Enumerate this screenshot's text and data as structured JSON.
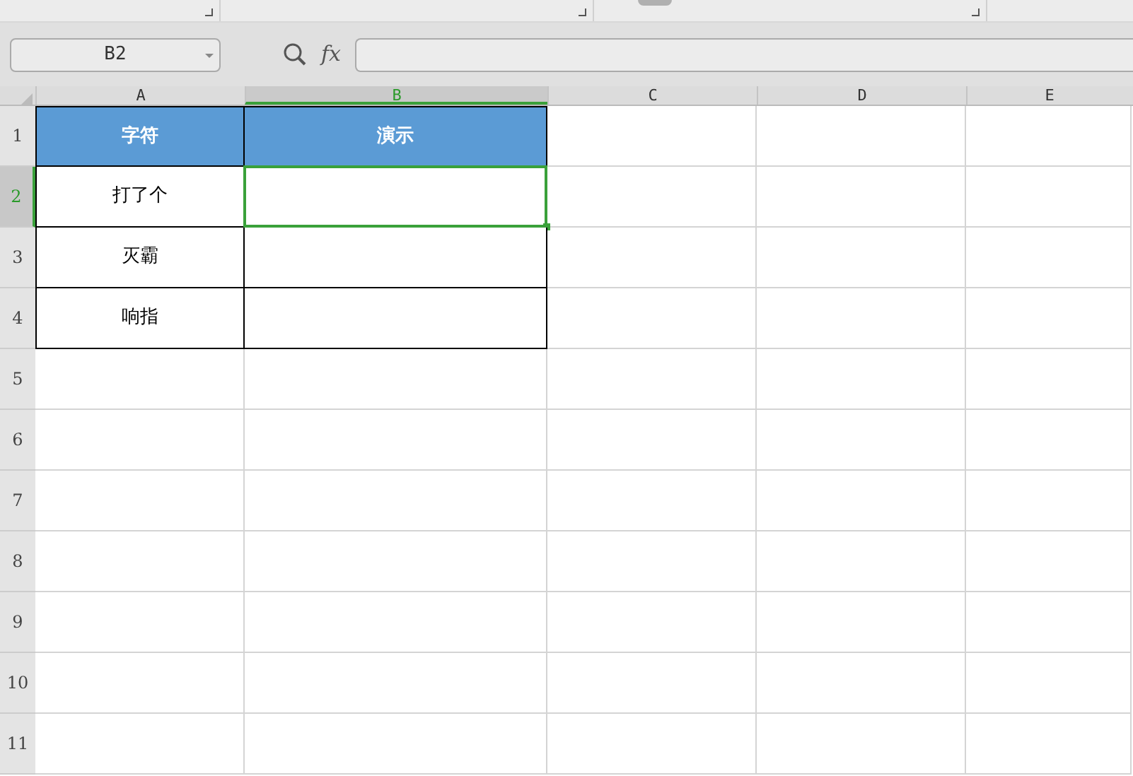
{
  "name_box": {
    "value": "B2"
  },
  "formula_bar": {
    "label": "fx"
  },
  "columns": [
    {
      "label": "A",
      "selected": false
    },
    {
      "label": "B",
      "selected": true
    },
    {
      "label": "C",
      "selected": false
    },
    {
      "label": "D",
      "selected": false
    },
    {
      "label": "E",
      "selected": false
    }
  ],
  "rows": [
    {
      "number": "1",
      "selected": false,
      "cells": [
        {
          "kind": "header",
          "text": "字符",
          "selected": false
        },
        {
          "kind": "header",
          "text": "演示",
          "selected": false
        }
      ]
    },
    {
      "number": "2",
      "selected": true,
      "cells": [
        {
          "kind": "boxed",
          "text": "打了个",
          "selected": false
        },
        {
          "kind": "boxed",
          "selected": true
        }
      ]
    },
    {
      "number": "3",
      "selected": false,
      "cells": [
        {
          "kind": "boxed",
          "text": "灭霸",
          "selected": false
        },
        {
          "kind": "boxed",
          "selected": false
        }
      ]
    },
    {
      "number": "4",
      "selected": false,
      "cells": [
        {
          "kind": "boxed",
          "text": "响指",
          "selected": false
        },
        {
          "kind": "boxed",
          "selected": false
        }
      ]
    },
    {
      "number": "5",
      "selected": false,
      "cells": []
    },
    {
      "number": "6",
      "selected": false,
      "cells": []
    },
    {
      "number": "7",
      "selected": false,
      "cells": []
    },
    {
      "number": "8",
      "selected": false,
      "cells": []
    },
    {
      "number": "9",
      "selected": false,
      "cells": []
    },
    {
      "number": "10",
      "selected": false,
      "cells": []
    },
    {
      "number": "11",
      "selected": false,
      "cells": []
    }
  ]
}
